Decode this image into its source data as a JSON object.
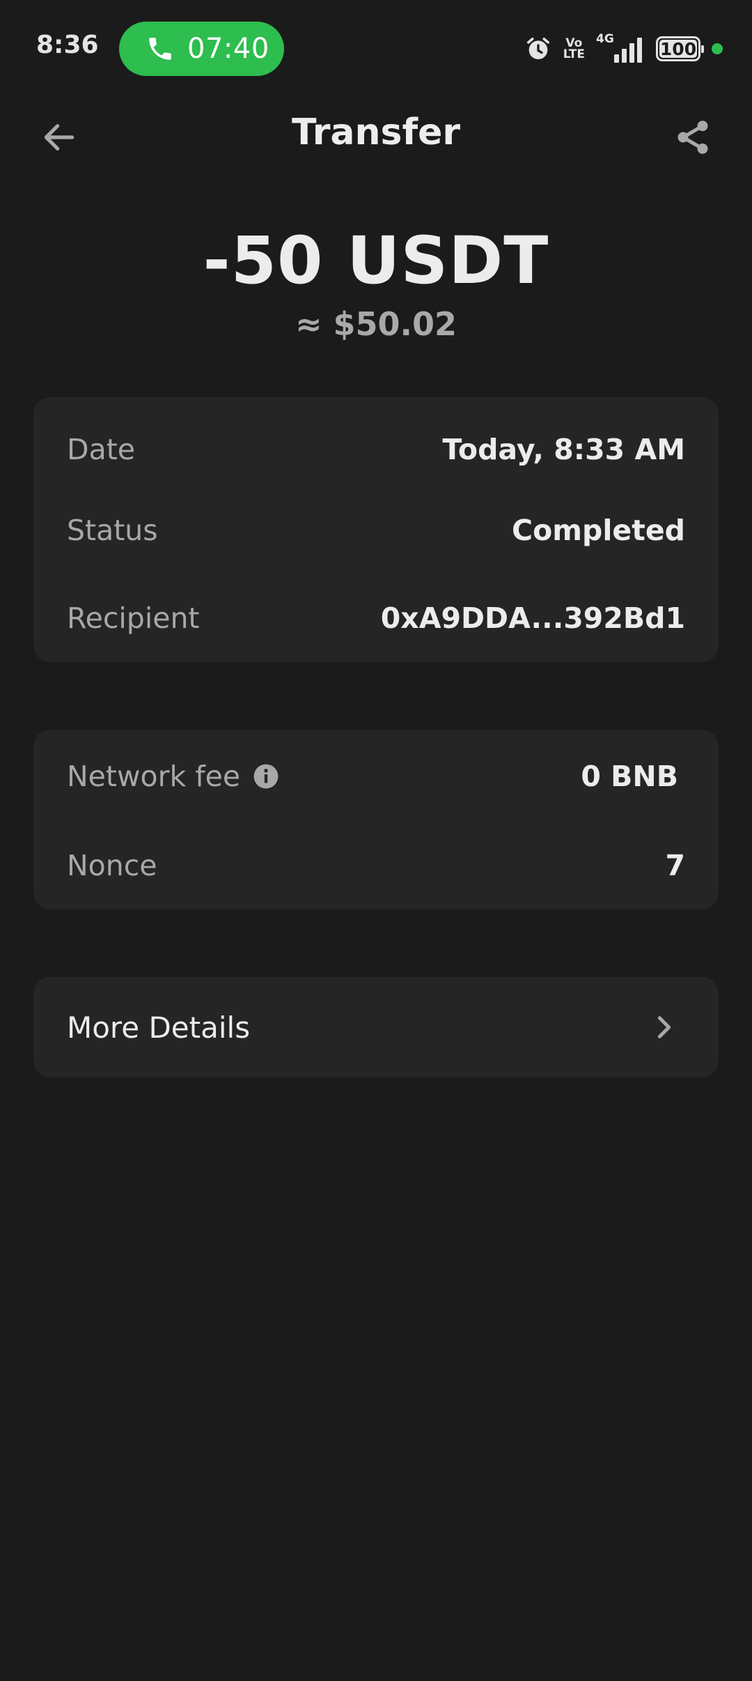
{
  "status_bar": {
    "time": "8:36",
    "call_duration": "07:40",
    "volte_top": "Vo",
    "volte_bottom": "LTE",
    "network": "4G",
    "battery": "100",
    "colors": {
      "call_pill": "#2ebd4f",
      "indicator_dot": "#2ebd4f"
    },
    "icons": [
      "phone-icon",
      "alarm-icon",
      "signal-icon",
      "battery-icon"
    ]
  },
  "header": {
    "title": "Transfer",
    "back_icon": "arrow-left-icon",
    "share_icon": "share-icon"
  },
  "amount": {
    "value": "-50 USDT",
    "fiat": "≈ $50.02"
  },
  "details": {
    "date_label": "Date",
    "date_value": "Today, 8:33 AM",
    "status_label": "Status",
    "status_value": "Completed",
    "recipient_label": "Recipient",
    "recipient_value": "0xA9DDA...392Bd1"
  },
  "fees": {
    "fee_label": "Network fee",
    "fee_value": "0 BNB",
    "nonce_label": "Nonce",
    "nonce_value": "7"
  },
  "more": {
    "label": "More Details",
    "icon": "chevron-right-icon"
  },
  "theme": {
    "background": "#1b1b1b",
    "card": "#252525",
    "text_primary": "#ececec",
    "text_secondary": "#a8a8a8"
  }
}
